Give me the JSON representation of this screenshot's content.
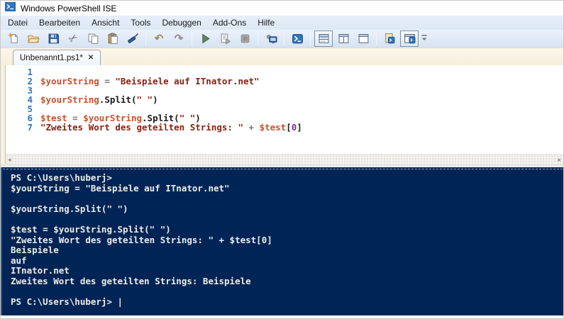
{
  "window": {
    "title": "Windows PowerShell ISE"
  },
  "menu": {
    "items": [
      "Datei",
      "Bearbeiten",
      "Ansicht",
      "Tools",
      "Debuggen",
      "Add-Ons",
      "Hilfe"
    ]
  },
  "toolbar": {
    "groups": [
      [
        "new-script",
        "open-script",
        "save-script",
        "cut",
        "copy",
        "paste",
        "clear-console"
      ],
      [
        "undo",
        "redo"
      ],
      [
        "run-script",
        "run-selection",
        "stop-operation"
      ],
      [
        "new-remote-powershell-tab"
      ],
      [
        "start-powershell-exe"
      ],
      [
        "show-script-pane-top",
        "show-script-pane-right",
        "show-script-pane-maximized"
      ],
      [
        "show-command-window",
        "show-script-pane"
      ]
    ],
    "selected": [
      "show-script-pane-top",
      "show-script-pane"
    ],
    "overflow": "toolbar-overflow"
  },
  "tab": {
    "label": "Unbenannt1.ps1*",
    "close_glyph": "✕"
  },
  "editor": {
    "lines": [
      {
        "num": "1",
        "tokens": []
      },
      {
        "num": "2",
        "tokens": [
          [
            "variable",
            "$yourString"
          ],
          [
            "operator",
            " = "
          ],
          [
            "string",
            "\"Beispiele auf ITnator.net\""
          ]
        ]
      },
      {
        "num": "3",
        "tokens": []
      },
      {
        "num": "4",
        "tokens": [
          [
            "variable",
            "$yourString"
          ],
          [
            "default",
            ".Split("
          ],
          [
            "string",
            "\" \""
          ],
          [
            "default",
            ")"
          ]
        ]
      },
      {
        "num": "5",
        "tokens": []
      },
      {
        "num": "6",
        "tokens": [
          [
            "variable",
            "$test"
          ],
          [
            "operator",
            " = "
          ],
          [
            "variable",
            "$yourString"
          ],
          [
            "default",
            ".Split("
          ],
          [
            "string",
            "\" \""
          ],
          [
            "default",
            ")"
          ]
        ]
      },
      {
        "num": "7",
        "tokens": [
          [
            "string",
            "\"Zweites Wort des geteilten Strings: \""
          ],
          [
            "operator",
            " + "
          ],
          [
            "variable",
            "$test"
          ],
          [
            "default",
            "["
          ],
          [
            "number",
            "0"
          ],
          [
            "default",
            "]"
          ]
        ]
      }
    ]
  },
  "console": {
    "lines": [
      "PS C:\\Users\\huberj>",
      "$yourString = \"Beispiele auf ITnator.net\"",
      "",
      "$yourString.Split(\" \")",
      "",
      "$test = $yourString.Split(\" \")",
      "\"Zweites Wort des geteilten Strings: \" + $test[0]",
      "Beispiele",
      "auf",
      "ITnator.net",
      "Zweites Wort des geteilten Strings: Beispiele",
      "",
      "PS C:\\Users\\huberj> "
    ],
    "cursor": "|"
  },
  "scrollbar": {
    "left_arrow": "◂",
    "right_arrow": "▸"
  },
  "colors": {
    "console_bg": "#012456",
    "accent_blue": "#2d77c0",
    "variable": "#c7512b",
    "string": "#8b1e10",
    "operator": "#7a7a7a",
    "number": "#7b2d8b",
    "line_number": "#2f76b8"
  }
}
